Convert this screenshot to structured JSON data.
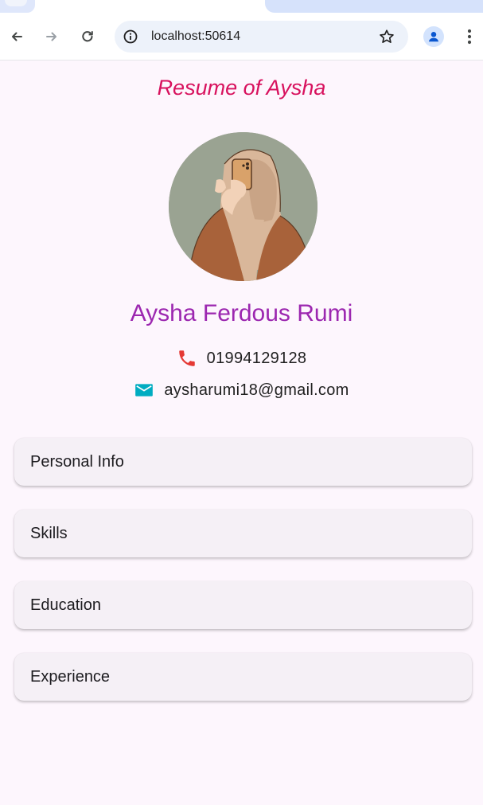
{
  "browser": {
    "url": "localhost:50614"
  },
  "page": {
    "title": "Resume of Aysha",
    "name": "Aysha Ferdous Rumi",
    "phone": "01994129128",
    "email": "aysharumi18@gmail.com"
  },
  "sections": [
    {
      "label": "Personal Info"
    },
    {
      "label": "Skills"
    },
    {
      "label": "Education"
    },
    {
      "label": "Experience"
    }
  ],
  "colors": {
    "title": "#d8125e",
    "name": "#9c27b0",
    "phone_icon": "#e53935",
    "email_icon": "#00acc1",
    "background": "#fdf6fd",
    "card": "#f5f0f6"
  },
  "icons": {
    "back": "arrow-left",
    "forward": "arrow-right",
    "reload": "reload",
    "site_info": "info-circle",
    "bookmark": "star-outline",
    "profile": "person",
    "menu": "three-dots-vertical",
    "phone": "phone",
    "email": "envelope"
  }
}
